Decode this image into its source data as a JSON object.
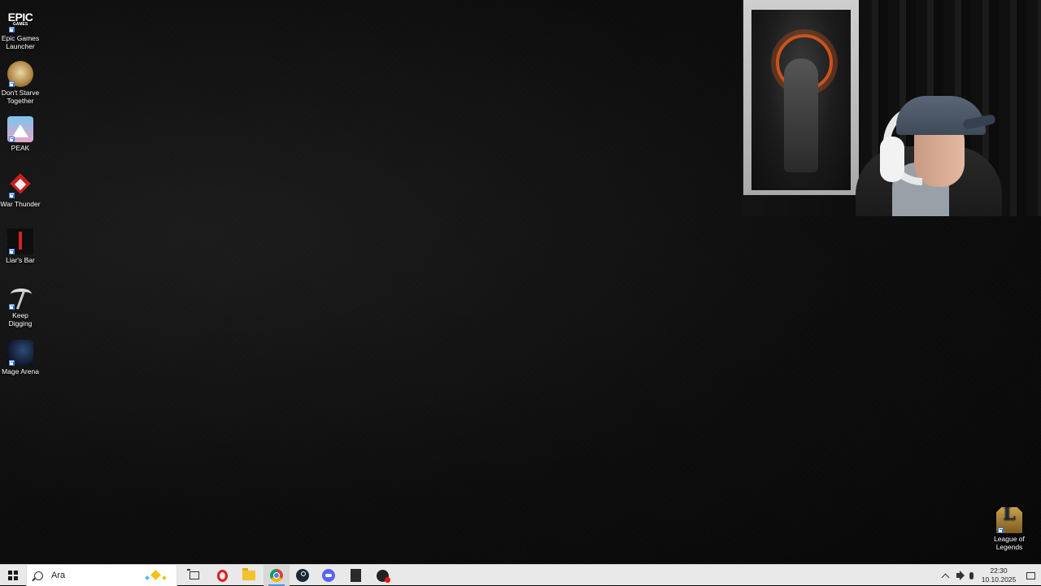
{
  "desktop": {
    "icons": [
      {
        "label": "Epic Games Launcher",
        "logo": "EPIC",
        "logo_sub": "GAMES",
        "icon": "epic-games-icon"
      },
      {
        "label": "Don't Starve Together",
        "icon": "dont-starve-icon"
      },
      {
        "label": "PEAK",
        "icon": "peak-icon"
      },
      {
        "label": "War Thunder",
        "icon": "war-thunder-icon"
      },
      {
        "label": "Liar's Bar",
        "icon": "liars-bar-icon"
      },
      {
        "label": "Keep Digging",
        "icon": "pickaxe-icon"
      },
      {
        "label": "Mage Arena",
        "icon": "mage-arena-icon"
      },
      {
        "label": "League of Legends",
        "icon": "league-of-legends-icon"
      }
    ]
  },
  "webcam": {
    "description_icon": "webcam-overlay"
  },
  "taskbar": {
    "search": {
      "value": "Ara"
    },
    "apps": [
      "task-view",
      "opera",
      "file-explorer",
      "chrome",
      "steam",
      "discord",
      "epic-games",
      "ea-app"
    ],
    "clock": {
      "time": "22:30",
      "date": "10.10.2025"
    }
  },
  "colors": {
    "taskbar_bg": "#e9e9e9",
    "accent": "#4a90d9",
    "desktop_bg": "#0b0b0b"
  }
}
